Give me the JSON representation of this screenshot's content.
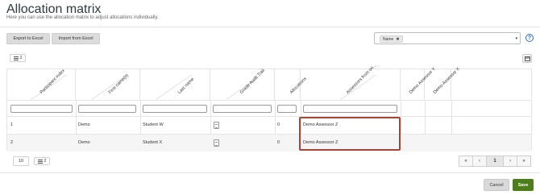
{
  "page": {
    "title": "Allocation matrix",
    "subtitle": "Here you can use the allocation matrix to adjust allocations individually."
  },
  "toolbar": {
    "export_label": "Export to Excel",
    "import_label": "Import from Excel",
    "columns_count": "2"
  },
  "name_filter": {
    "tag_label": "Name",
    "tag_remove": "✖",
    "caret": "▾"
  },
  "help": {
    "glyph": "?"
  },
  "grid": {
    "columns": [
      "Participant index",
      "First name(s)",
      "Last name",
      "Grade Audit Trail",
      "Allocations",
      "Assessors from ori...",
      "Demo Assessor Y",
      "Demo Assessor X"
    ],
    "rows": [
      {
        "index": "1",
        "first": "Demo",
        "last": "Student W",
        "allocations": "0",
        "assessor": "Demo Assessor Z"
      },
      {
        "index": "2",
        "first": "Demo",
        "last": "Student X",
        "allocations": "0",
        "assessor": "Demo Assessor Z"
      }
    ]
  },
  "footer": {
    "page_size": "10",
    "columns_count": "2",
    "pager": {
      "first": "«",
      "prev": "‹",
      "current": "1",
      "next": "›",
      "last": "»"
    },
    "cancel_label": "Cancel",
    "save_label": "Save"
  },
  "colors": {
    "accent": "#4f7d1d",
    "highlight": "#9b4a3a",
    "help": "#2a6ebb"
  },
  "icons": {
    "columns": "list-icon",
    "grid_toggle": "table-icon",
    "audit": "clipboard-icon"
  }
}
